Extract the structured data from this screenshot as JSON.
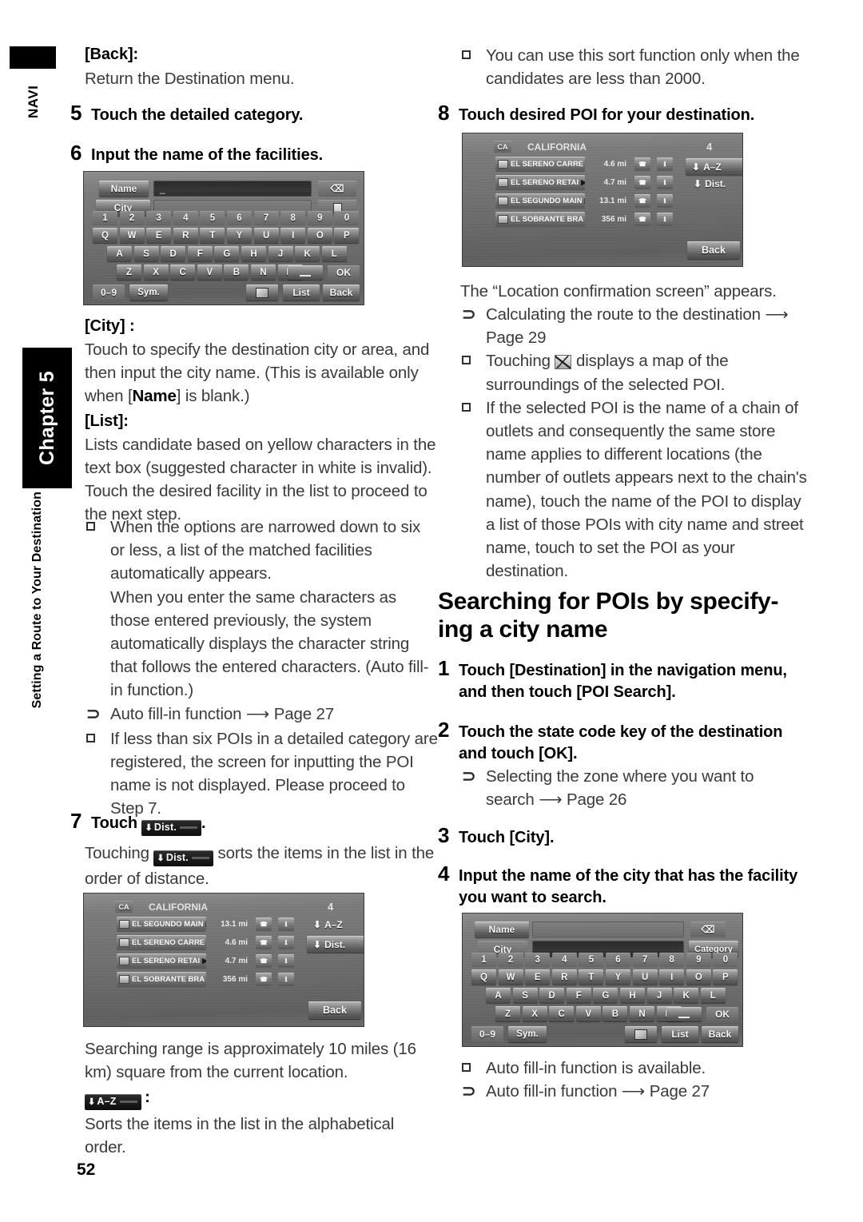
{
  "sidebar": {
    "navi_label": "NAVI",
    "chapter_label": "Chapter 5",
    "chapter_subtitle": "Setting a Route to Your Destination"
  },
  "page_number": "52",
  "left_column": {
    "back_label": "[Back]:",
    "back_desc": "Return the Destination menu.",
    "step5": {
      "num": "5",
      "text": "Touch the detailed category."
    },
    "step6": {
      "num": "6",
      "text": "Input the name of the facilities."
    },
    "city_label": "[City] :",
    "city_desc_1": "Touch to specify the destination city or area, and then input the city name. (This is available only when [",
    "city_desc_name": "Name",
    "city_desc_2": "] is blank.)",
    "list_label": "[List]:",
    "list_desc": "Lists candidate based on yellow characters in the text box (suggested character in white is invalid). Touch the desired facility in the list to proceed to the next step.",
    "bullet_narrowed": "When the options are narrowed down to six or less, a list of the matched facilities automatically appears.",
    "bullet_narrowed_cont": "When you enter the same characters as those entered previously, the system automatically displays the character string that follows the entered characters. (Auto fill-in function.)",
    "ref_autofill": "Auto fill-in function",
    "ref_autofill_page": "Page 27",
    "bullet_lessthan6": "If less than six POIs in a detailed category are registered, the screen for inputting the POI name is not displayed. Please proceed to Step 7.",
    "step7": {
      "num": "7",
      "text_before": "Touch",
      "text_after": "."
    },
    "step7_desc_before": "Touching",
    "step7_desc_after": "sorts the items in the list in the order of distance.",
    "range_note": "Searching range is approximately 10 miles (16 km) square from the current location.",
    "az_colon": ":",
    "az_desc": "Sorts the items in the list in the alphabetical order.",
    "dist_chip": "Dist.",
    "az_chip": "A–Z"
  },
  "right_column": {
    "bullet_sort": "You can use this sort function only when the candidates are less than 2000.",
    "step8": {
      "num": "8",
      "text_a": "Touch desired ",
      "text_b": "POI",
      "text_c": " for your destination."
    },
    "loc_conf": "The “Location confirmation screen” appears.",
    "ref_calc": "Calculating the route to the destination",
    "ref_calc_page": "Page 29",
    "bullet_map_before": "Touching",
    "bullet_map_after": "displays a map of the surroundings of the selected POI.",
    "bullet_chain": "If the selected POI is the name of a chain of outlets and consequently the same store name applies to different locations (the number of outlets appears next to the chain's name), touch the name of the POI to display a list of those POIs with city name and street name, touch to set the POI as your destination.",
    "heading_l1": "Searching for POIs by specify-",
    "heading_l2": "ing a city name",
    "heading_plain": "Searching for POIs by specifying a city name",
    "step1": {
      "num": "1",
      "text": "Touch [Destination] in the navigation menu, and then touch [POI Search]."
    },
    "step2": {
      "num": "2",
      "text": "Touch the state code key of the destination and touch [OK]."
    },
    "ref_zone": "Selecting the zone where you want to search",
    "ref_zone_page": "Page 26",
    "step3": {
      "num": "3",
      "text": "Touch [City]."
    },
    "step4": {
      "num": "4",
      "text": "Input the name of the city that has the facility you want to search."
    },
    "bullet_autofill_avail": "Auto fill-in function is available.",
    "ref_autofill": "Auto fill-in function",
    "ref_autofill_page": "Page 27"
  },
  "screens": {
    "keyboard_name": {
      "field_labels": {
        "name": "Name",
        "city": "City"
      },
      "name_value": "_",
      "city_value": "",
      "backspace_icon": "backspace-icon",
      "list_icon": "list-icon",
      "rows": {
        "digits": [
          "1",
          "2",
          "3",
          "4",
          "5",
          "6",
          "7",
          "8",
          "9",
          "0"
        ],
        "r1": [
          "Q",
          "W",
          "E",
          "R",
          "T",
          "Y",
          "U",
          "I",
          "O",
          "P"
        ],
        "r2": [
          "A",
          "S",
          "D",
          "F",
          "G",
          "H",
          "J",
          "K",
          "L"
        ],
        "r3": [
          "Z",
          "X",
          "C",
          "V",
          "B",
          "N",
          "M"
        ]
      },
      "space_label": "␣",
      "ok_label": "OK",
      "num_toggle": "0–9",
      "sym_label": "Sym.",
      "map_label": "map-icon",
      "list_label": "List",
      "back_label": "Back"
    },
    "keyboard_city": {
      "field_labels": {
        "name": "Name",
        "city": "City"
      },
      "name_value": "",
      "city_value": "_",
      "category_label": "Category",
      "backspace_icon": "backspace-icon",
      "rows": {
        "digits": [
          "1",
          "2",
          "3",
          "4",
          "5",
          "6",
          "7",
          "8",
          "9",
          "0"
        ],
        "r1": [
          "Q",
          "W",
          "E",
          "R",
          "T",
          "Y",
          "U",
          "I",
          "O",
          "P"
        ],
        "r2": [
          "A",
          "S",
          "D",
          "F",
          "G",
          "H",
          "J",
          "K",
          "L"
        ],
        "r3": [
          "Z",
          "X",
          "C",
          "V",
          "B",
          "N",
          "M"
        ]
      },
      "space_label": "␣",
      "ok_label": "OK",
      "num_toggle": "0–9",
      "sym_label": "Sym.",
      "map_label": "map-icon",
      "list_label": "List",
      "back_label": "Back"
    },
    "poi_list_az": {
      "state": "CALIFORNIA",
      "count": "4",
      "sort_az": "A–Z",
      "sort_dist": "Dist.",
      "back_label": "Back",
      "rows": [
        {
          "name": "EL SEGUNDO MAIN",
          "dist": "13.1",
          "unit": "mi"
        },
        {
          "name": "EL SERENO CARRE",
          "dist": "4.6",
          "unit": "mi"
        },
        {
          "name": "EL SERENO RETAI",
          "dist": "4.7",
          "unit": "mi"
        },
        {
          "name": "EL SOBRANTE BRA",
          "dist": "356",
          "unit": "mi"
        }
      ]
    },
    "poi_list_dist": {
      "state": "CALIFORNIA",
      "count": "4",
      "sort_az": "A–Z",
      "sort_dist": "Dist.",
      "back_label": "Back",
      "rows": [
        {
          "name": "EL SERENO CARRE",
          "dist": "4.6",
          "unit": "mi"
        },
        {
          "name": "EL SERENO RETAI",
          "dist": "4.7",
          "unit": "mi"
        },
        {
          "name": "EL SEGUNDO MAIN",
          "dist": "13.1",
          "unit": "mi"
        },
        {
          "name": "EL SOBRANTE BRA",
          "dist": "356",
          "unit": "mi"
        }
      ]
    }
  }
}
